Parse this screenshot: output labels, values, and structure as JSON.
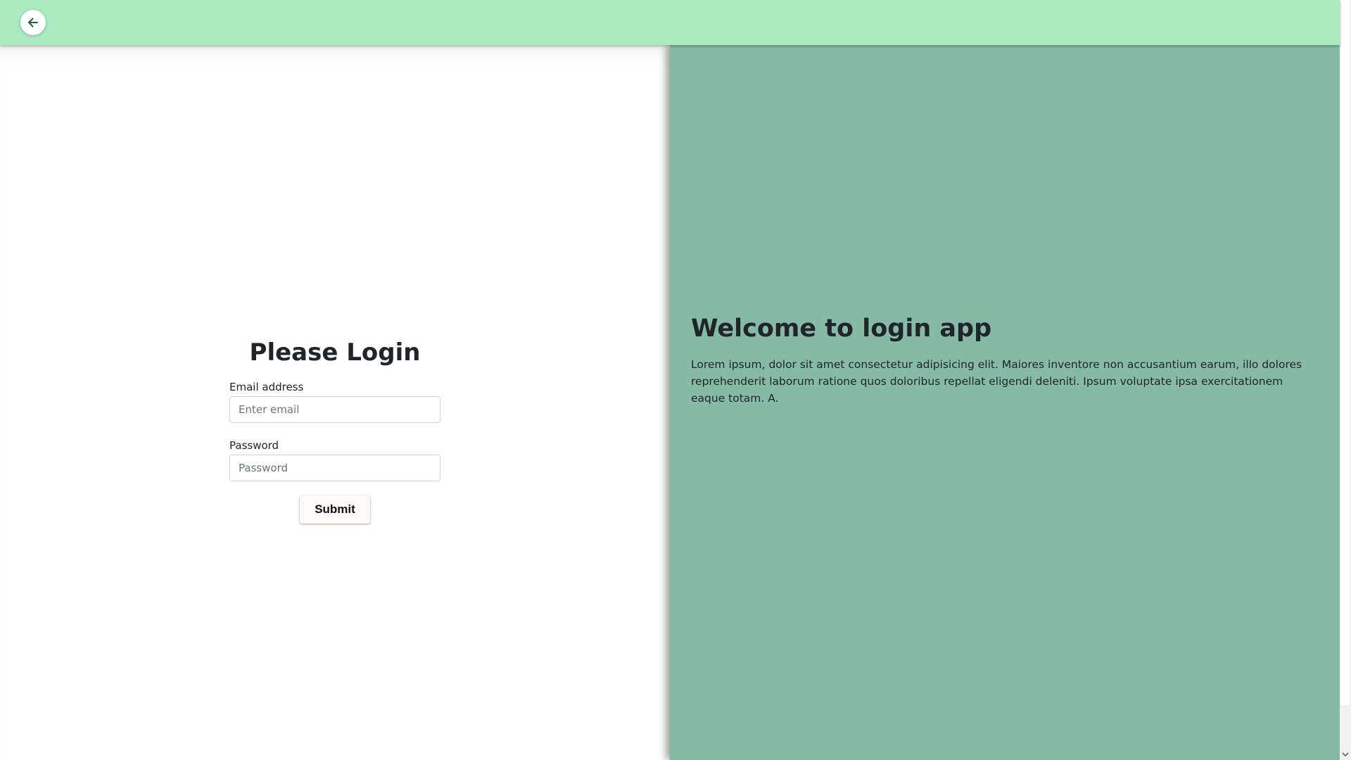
{
  "header": {
    "back_icon": "arrow-left-icon",
    "background_color": "#abebc0"
  },
  "login": {
    "title": "Please Login",
    "email_label": "Email address",
    "email_placeholder": "Enter email",
    "email_value": "",
    "password_label": "Password",
    "password_placeholder": "Password",
    "password_value": "",
    "submit_label": "Submit"
  },
  "welcome": {
    "title": "Welcome to login app",
    "body": "Lorem ipsum, dolor sit amet consectetur adipisicing elit. Maiores inventore non accusantium earum, illo dolores reprehenderit laborum ratione quos doloribus repellat eligendi deleniti. Ipsum voluptate ipsa exercitationem eaque totam. A.",
    "background_color": "#85baa6"
  },
  "scrollbar": {
    "down_icon": "chevron-down-icon"
  }
}
